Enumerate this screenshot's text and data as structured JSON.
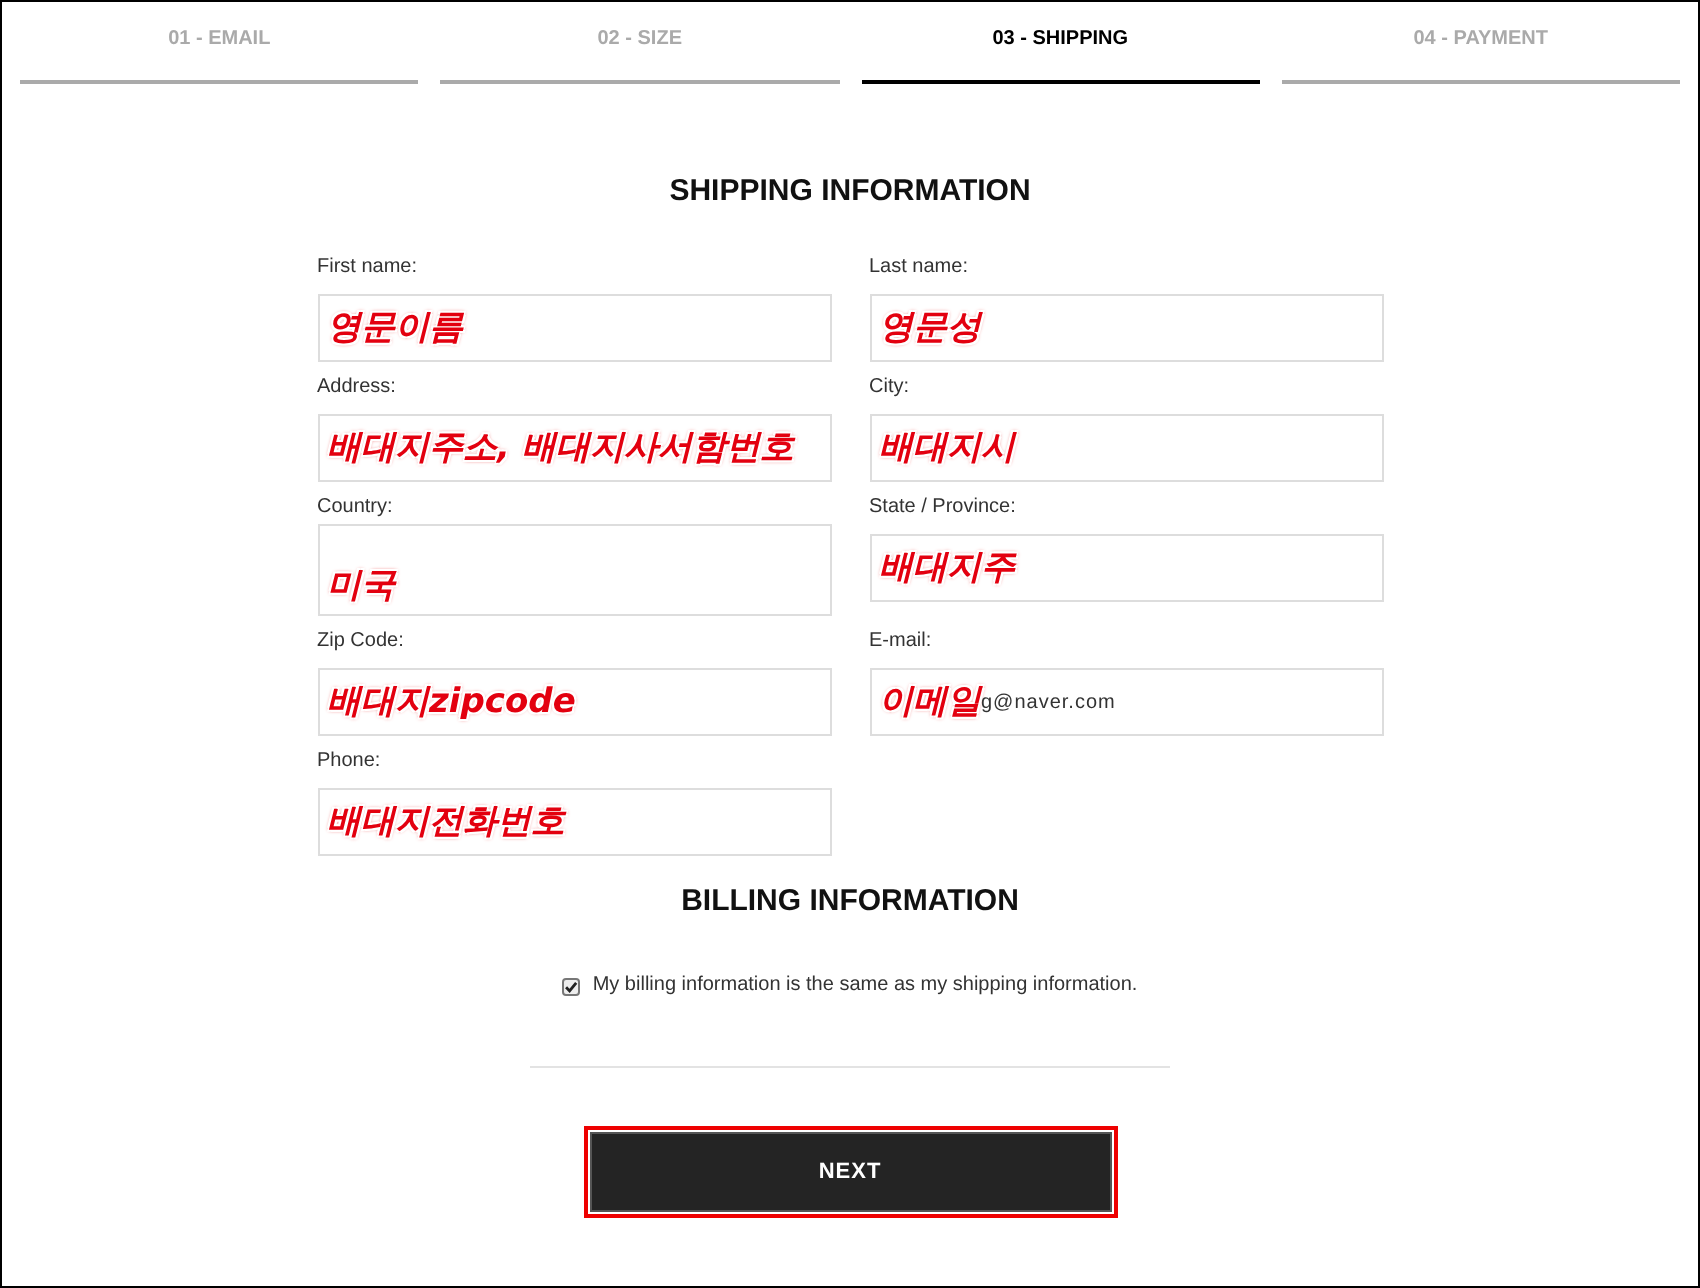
{
  "steps": [
    {
      "label": "01 - EMAIL",
      "selected": false
    },
    {
      "label": "02 - SIZE",
      "selected": false
    },
    {
      "label": "03 - SHIPPING",
      "selected": true
    },
    {
      "label": "04 - PAYMENT",
      "selected": false
    }
  ],
  "shipping": {
    "title": "SHIPPING INFORMATION",
    "fields": [
      {
        "label": "First name:",
        "kind": "text",
        "annotation": "영문이름"
      },
      {
        "label": "Last name:",
        "kind": "text",
        "annotation": "영문성"
      },
      {
        "label": "Address:",
        "kind": "text",
        "annotation": "배대지주소, 배대지사서함번호"
      },
      {
        "label": "City:",
        "kind": "text",
        "annotation": "배대지시"
      },
      {
        "label": "Country:",
        "kind": "select",
        "annotation": "미국"
      },
      {
        "label": "State / Province:",
        "kind": "text",
        "annotation": "배대지주"
      },
      {
        "label": "Zip Code:",
        "kind": "text",
        "annotation": "배대지zipcode"
      },
      {
        "label": "E-mail:",
        "kind": "text",
        "annotation": "이메일",
        "value": "g@naver.com"
      },
      {
        "label": "Phone:",
        "kind": "text",
        "annotation": "배대지전화번호"
      }
    ]
  },
  "billing": {
    "title": "BILLING INFORMATION",
    "same_as_shipping": {
      "label": "My billing information is the same as my shipping information.",
      "checked": true
    }
  },
  "next_button": {
    "label": "NEXT",
    "highlighted": true
  }
}
